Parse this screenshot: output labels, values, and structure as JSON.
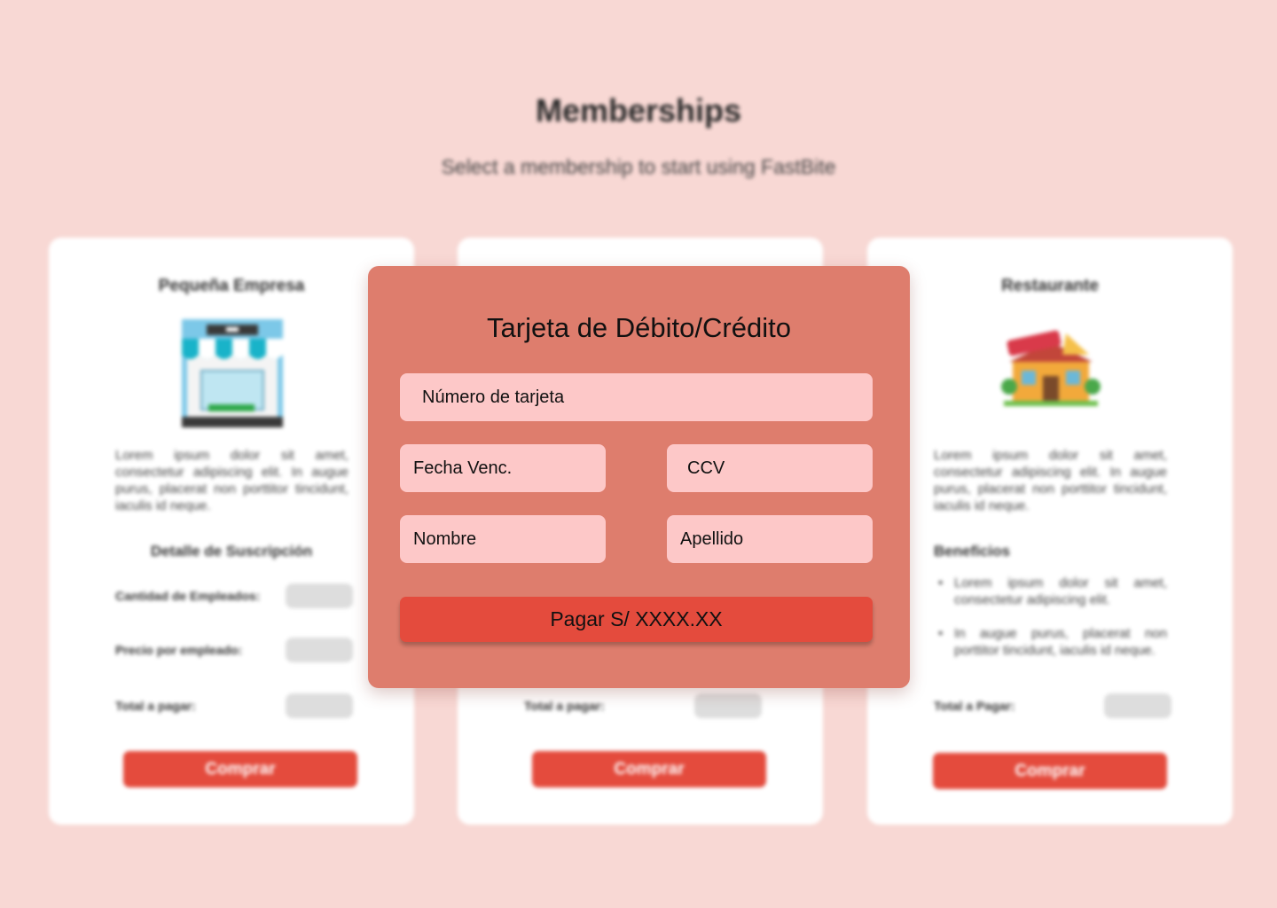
{
  "header": {
    "title": "Memberships",
    "subtitle": "Select a membership to start using FastBite"
  },
  "cards": [
    {
      "title": "Pequeña Empresa",
      "image": "store-illustration",
      "description": "Lorem ipsum dolor sit amet, consectetur adipiscing elit. In augue purus, placerat non porttitor tincidunt, iaculis id neque.",
      "section_title": "Detalle de Suscripción",
      "rows": [
        {
          "label": "Cantidad de Empleados:"
        },
        {
          "label": "Precio por empleado:"
        },
        {
          "label": "Total a pagar:"
        }
      ],
      "button": "Comprar"
    },
    {
      "title": "",
      "rows": [
        {
          "label": "Total a pagar:"
        }
      ],
      "button": "Comprar"
    },
    {
      "title": "Restaurante",
      "image": "restaurant-illustration",
      "description": "Lorem ipsum dolor sit amet, consectetur adipiscing elit. In augue purus, placerat non porttitor tincidunt, iaculis id neque.",
      "section_title": "Beneficios",
      "benefits": [
        "Lorem ipsum dolor sit amet, consectetur adipiscing elit.",
        "In augue purus, placerat non porttitor tincidunt, iaculis id neque."
      ],
      "rows": [
        {
          "label": "Total a Pagar:"
        }
      ],
      "button": "Comprar"
    }
  ],
  "modal": {
    "title": "Tarjeta de Débito/Crédito",
    "fields": {
      "card_number": "Número de tarjeta",
      "expiry": "Fecha Venc.",
      "ccv": "CCV",
      "first_name": "Nombre",
      "last_name": "Apellido"
    },
    "pay_button": "Pagar S/ XXXX.XX"
  },
  "colors": {
    "background": "#f8d8d4",
    "modal": "#de7d6d",
    "field": "#fdc8c8",
    "accent": "#e44b3d"
  }
}
